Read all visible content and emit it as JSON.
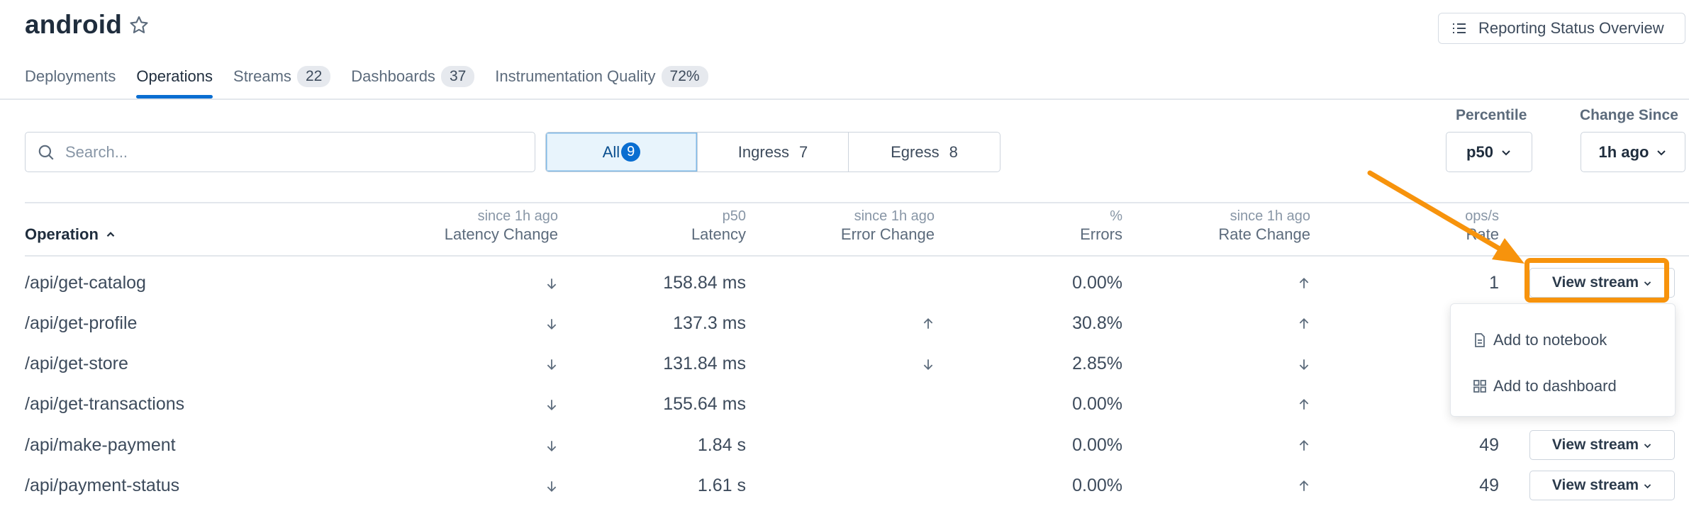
{
  "header": {
    "title": "android",
    "report_button": "Reporting Status Overview"
  },
  "tabs": [
    {
      "label": "Deployments",
      "badge": null,
      "active": false
    },
    {
      "label": "Operations",
      "badge": null,
      "active": true
    },
    {
      "label": "Streams",
      "badge": "22",
      "active": false
    },
    {
      "label": "Dashboards",
      "badge": "37",
      "active": false
    },
    {
      "label": "Instrumentation Quality",
      "badge": "72%",
      "active": false
    }
  ],
  "search": {
    "placeholder": "Search..."
  },
  "segments": [
    {
      "label": "All",
      "count": "9",
      "active": true
    },
    {
      "label": "Ingress",
      "count": "7",
      "active": false
    },
    {
      "label": "Egress",
      "count": "8",
      "active": false
    }
  ],
  "percentile": {
    "label": "Percentile",
    "value": "p50"
  },
  "change_since": {
    "label": "Change Since",
    "value": "1h ago"
  },
  "columns": {
    "operation": "Operation",
    "latency_change": {
      "sub": "since 1h ago",
      "main": "Latency Change"
    },
    "latency": {
      "sub": "p50",
      "main": "Latency"
    },
    "error_change": {
      "sub": "since 1h ago",
      "main": "Error Change"
    },
    "errors": {
      "sub": "%",
      "main": "Errors"
    },
    "rate_change": {
      "sub": "since 1h ago",
      "main": "Rate Change"
    },
    "rate": {
      "sub": "ops/s",
      "main": "Rate"
    }
  },
  "rows": [
    {
      "name": "/api/get-catalog",
      "latency_change": "down",
      "latency": "158.84 ms",
      "error_change": "",
      "errors": "0.00%",
      "rate_change": "up",
      "rate": "1",
      "button": "View stream"
    },
    {
      "name": "/api/get-profile",
      "latency_change": "down",
      "latency": "137.3 ms",
      "error_change": "up",
      "errors": "30.8%",
      "rate_change": "up",
      "rate": "",
      "button": ""
    },
    {
      "name": "/api/get-store",
      "latency_change": "down",
      "latency": "131.84 ms",
      "error_change": "down",
      "errors": "2.85%",
      "rate_change": "down",
      "rate": "",
      "button": ""
    },
    {
      "name": "/api/get-transactions",
      "latency_change": "down",
      "latency": "155.64 ms",
      "error_change": "",
      "errors": "0.00%",
      "rate_change": "up",
      "rate": "",
      "button": ""
    },
    {
      "name": "/api/make-payment",
      "latency_change": "down",
      "latency": "1.84 s",
      "error_change": "",
      "errors": "0.00%",
      "rate_change": "up",
      "rate": "49",
      "button": "View stream"
    },
    {
      "name": "/api/payment-status",
      "latency_change": "down",
      "latency": "1.61 s",
      "error_change": "",
      "errors": "0.00%",
      "rate_change": "up",
      "rate": "49",
      "button": "View stream"
    }
  ],
  "menu": {
    "items": [
      {
        "label": "Add to notebook",
        "icon": "document-icon"
      },
      {
        "label": "Add to dashboard",
        "icon": "grid-icon"
      }
    ]
  },
  "colors": {
    "accent": "#0a6ed1",
    "annotation": "#f7930c"
  }
}
